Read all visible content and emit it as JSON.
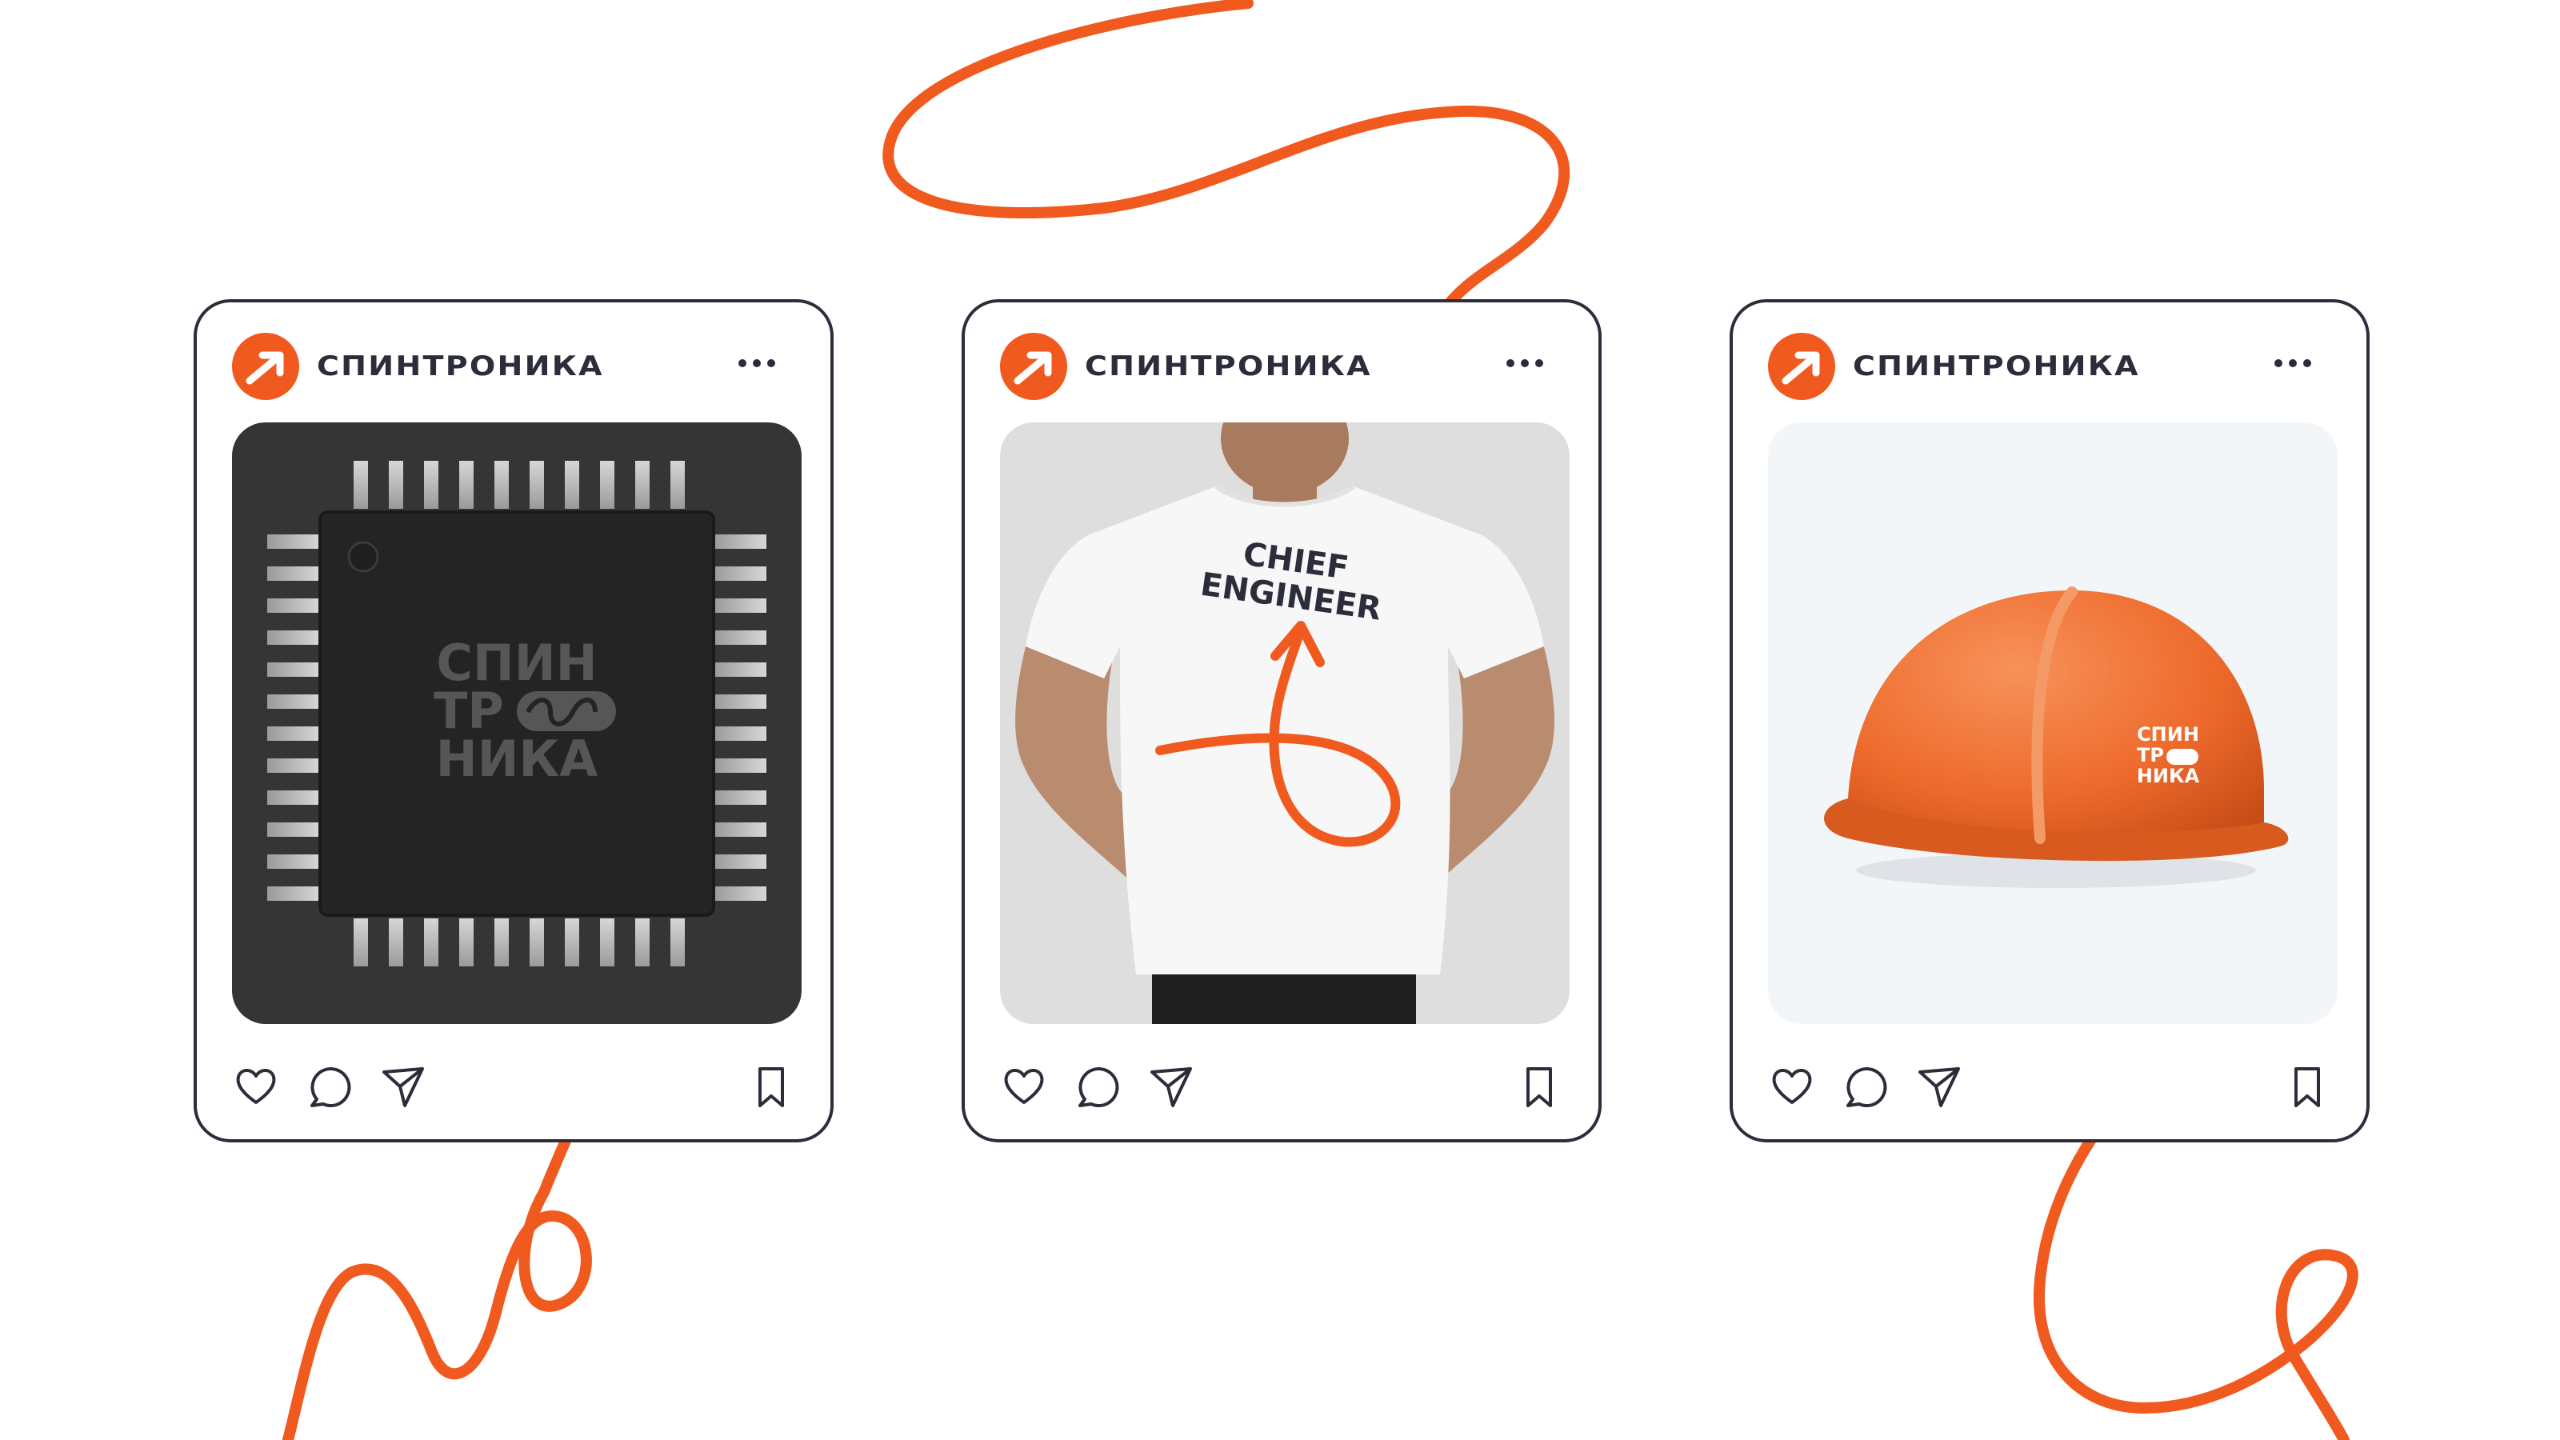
{
  "posts": [
    {
      "account_name": "СПИНТРОНИКА",
      "image_alt": "chip",
      "chip_logo": [
        "СПИН",
        "ТР",
        "НИКА"
      ]
    },
    {
      "account_name": "СПИНТРОНИКА",
      "image_alt": "tshirt",
      "shirt_text": [
        "CHIEF",
        "ENGINEER"
      ]
    },
    {
      "account_name": "СПИНТРОНИКА",
      "image_alt": "helmet",
      "helmet_logo": [
        "СПИН",
        "ТР",
        "НИКА"
      ]
    }
  ],
  "icons": {
    "avatar": "arrow-logo-icon",
    "more": "more-dots-icon",
    "like": "heart-icon",
    "comment": "comment-icon",
    "share": "send-icon",
    "save": "bookmark-icon"
  },
  "colors": {
    "accent": "#f05a1f",
    "ink": "#2b2d3a",
    "chip": "#353535",
    "helmet": "#ee6a2c",
    "helmet_bg": "#f3f6f9"
  }
}
